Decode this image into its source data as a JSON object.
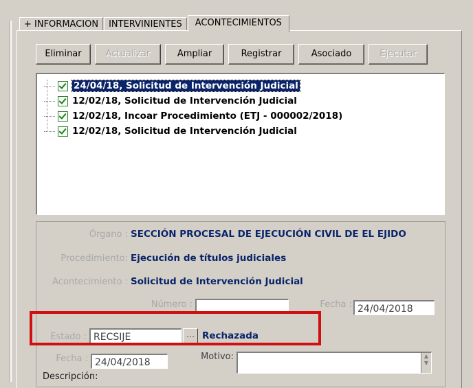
{
  "tabs": [
    {
      "label": "+ INFORMACION"
    },
    {
      "label": "INTERVINIENTES"
    },
    {
      "label": "ACONTECIMIENTOS"
    }
  ],
  "toolbar": {
    "eliminar": "Eliminar",
    "actualizar": "Actualizar",
    "ampliar": "Ampliar",
    "registrar": "Registrar",
    "asociado": "Asociado",
    "ejecutar": "Ejecutar"
  },
  "events": [
    {
      "text": "24/04/18, Solicitud de Intervención Judicial",
      "selected": true
    },
    {
      "text": "12/02/18, Solicitud de Intervención Judicial",
      "selected": false
    },
    {
      "text": "12/02/18, Incoar Procedimiento (ETJ - 000002/2018)",
      "selected": false
    },
    {
      "text": "12/02/18, Solicitud de Intervención Judicial",
      "selected": false
    }
  ],
  "details": {
    "organo_label": "Órgano :",
    "organo_value": "SECCIÓN PROCESAL DE EJECUCIÓN CIVIL DE EL EJIDO",
    "procedimiento_label": "Procedimiento:",
    "procedimiento_value": "Ejecución de títulos judiciales",
    "acontecimiento_label": "Acontecimiento :",
    "acontecimiento_value": "Solicitud de Intervención Judicial",
    "numero_label": "Número :",
    "numero_value": "",
    "fecha_label": "Fecha :",
    "fecha_value": "24/04/2018",
    "estado_label": "Estado :",
    "estado_code": "RECSIJE",
    "estado_ellipsis": "...",
    "estado_text": "Rechazada",
    "fecha2_label": "Fecha :",
    "fecha2_value": "24/04/2018",
    "motivo_label": "Motivo:",
    "motivo_value": "",
    "descripcion_label": "Descripción:"
  },
  "colors": {
    "highlight": "#d01010",
    "value_text": "#0a246a",
    "selection": "#0a246a"
  }
}
